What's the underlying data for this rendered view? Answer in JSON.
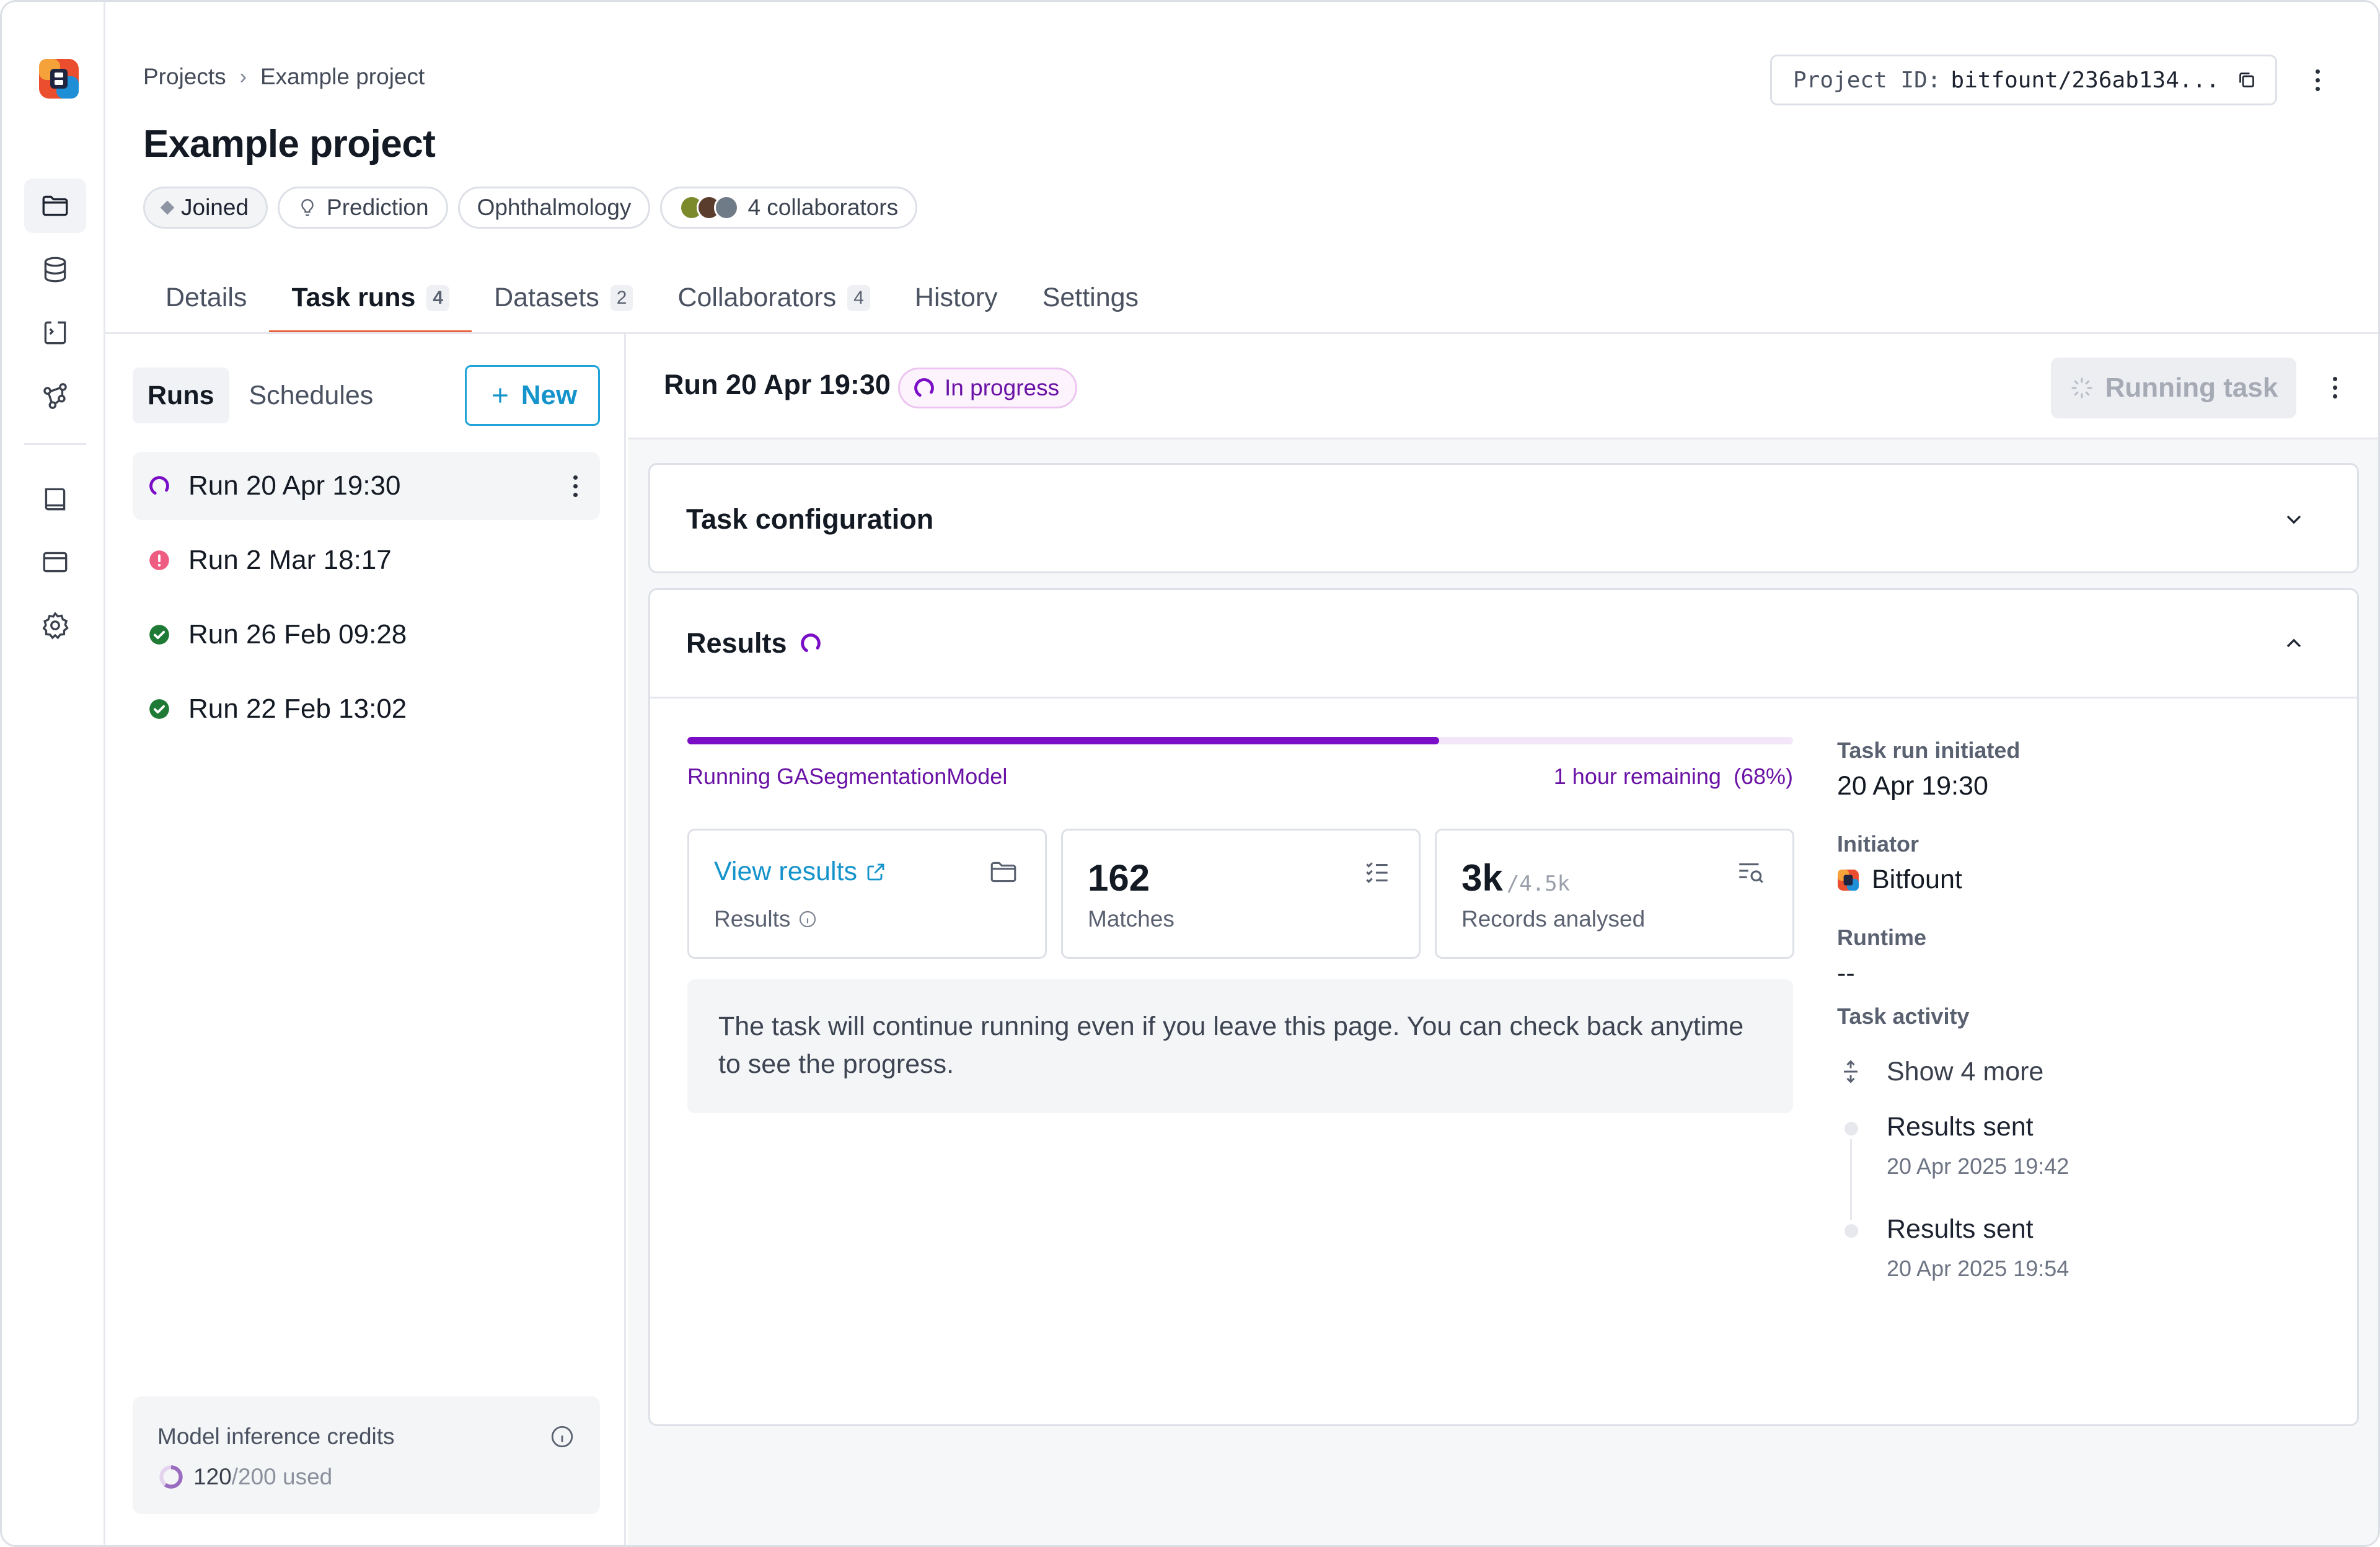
{
  "app": {
    "brand_colors": {
      "accent": "#1593cb",
      "progress": "#7a0ec7",
      "tab_underline": "#e8623e"
    }
  },
  "rail": {
    "items": [
      "folder-icon",
      "database-icon",
      "code-file-icon",
      "network-icon",
      "book-icon",
      "window-icon",
      "gear-icon"
    ]
  },
  "header": {
    "breadcrumb": {
      "root": "Projects",
      "current": "Example project"
    },
    "title": "Example project",
    "chips": {
      "joined": "Joined",
      "prediction": "Prediction",
      "ophthalmology": "Ophthalmology",
      "collaborators": "4 collaborators"
    },
    "project_id_label": "Project ID:",
    "project_id_value": "bitfount/236ab134..."
  },
  "tabs": [
    {
      "label": "Details",
      "count": ""
    },
    {
      "label": "Task runs",
      "count": "4"
    },
    {
      "label": "Datasets",
      "count": "2"
    },
    {
      "label": "Collaborators",
      "count": "4"
    },
    {
      "label": "History",
      "count": ""
    },
    {
      "label": "Settings",
      "count": ""
    }
  ],
  "runs_panel": {
    "segment": {
      "runs": "Runs",
      "schedules": "Schedules"
    },
    "new_button": "New",
    "runs": [
      {
        "label": "Run 20 Apr 19:30",
        "status": "in-progress"
      },
      {
        "label": "Run 2 Mar 18:17",
        "status": "error"
      },
      {
        "label": "Run 26 Feb 09:28",
        "status": "success"
      },
      {
        "label": "Run 22 Feb 13:02",
        "status": "success"
      }
    ],
    "credits": {
      "title": "Model inference credits",
      "used": "120",
      "total": "/200 used",
      "fraction": 0.6
    }
  },
  "main": {
    "run_title": "Run 20 Apr 19:30",
    "status_badge": "In progress",
    "running_button": "Running task",
    "task_config_title": "Task configuration",
    "results_title": "Results",
    "progress": {
      "label": "Running GASegmentationModel",
      "remaining": "1 hour remaining",
      "percent_text": "(68%)",
      "fraction": 0.68
    },
    "stats": {
      "view_results": "View results",
      "results_label": "Results",
      "matches_value": "162",
      "matches_label": "Matches",
      "records_value": "3k",
      "records_total": "/4.5k",
      "records_label": "Records analysed"
    },
    "note": "The task will continue running even if you leave this page. You can check back anytime to see the progress.",
    "side": {
      "initiated_label": "Task run initiated",
      "initiated_value": "20 Apr 19:30",
      "initiator_label": "Initiator",
      "initiator_value": "Bitfount",
      "runtime_label": "Runtime",
      "runtime_value": "--",
      "activity_label": "Task activity",
      "show_more": "Show 4 more",
      "activity": [
        {
          "title": "Results sent",
          "time": "20 Apr 2025 19:42"
        },
        {
          "title": "Results sent",
          "time": "20 Apr 2025 19:54"
        }
      ]
    }
  }
}
